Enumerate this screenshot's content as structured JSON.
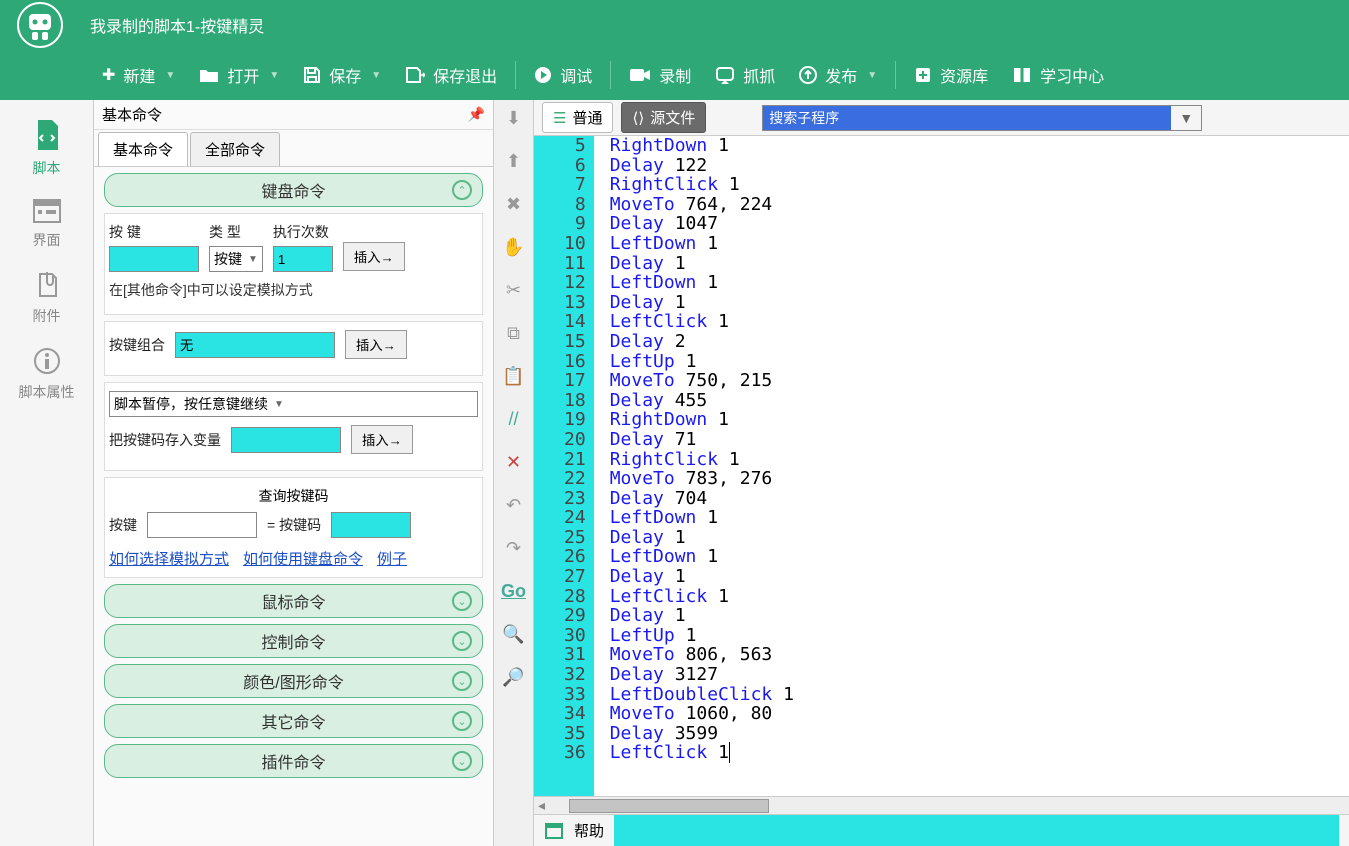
{
  "app": {
    "title": "我录制的脚本1-按键精灵"
  },
  "toolbar": {
    "new": "新建",
    "open": "打开",
    "save": "保存",
    "save_exit": "保存退出",
    "debug": "调试",
    "record": "录制",
    "grab": "抓抓",
    "publish": "发布",
    "resources": "资源库",
    "learn": "学习中心"
  },
  "rail": {
    "script": "脚本",
    "ui": "界面",
    "attach": "附件",
    "props": "脚本属性"
  },
  "panel": {
    "title": "基本命令",
    "tab_basic": "基本命令",
    "tab_all": "全部命令",
    "group_keyboard": "键盘命令",
    "key_label": "按 键",
    "type_label": "类 型",
    "count_label": "执行次数",
    "type_value": "按键",
    "count_value": "1",
    "insert": "插入→",
    "hint1": "在[其他命令]中可以设定模拟方式",
    "combo_label": "按键组合",
    "combo_value": "无",
    "pause_value": "脚本暂停，按任意键继续",
    "store_label": "把按键码存入变量",
    "lookup_title": "查询按键码",
    "lookup_key": "按键",
    "lookup_eq": "= 按键码",
    "link1": "如何选择模拟方式",
    "link2": "如何使用键盘命令",
    "link3": "例子",
    "group_mouse": "鼠标命令",
    "group_control": "控制命令",
    "group_color": "颜色/图形命令",
    "group_other": "其它命令",
    "group_plugin": "插件命令"
  },
  "editor": {
    "mode_normal": "普通",
    "mode_source": "源文件",
    "search_placeholder": "搜索子程序",
    "help_label": "帮助"
  },
  "code": [
    {
      "n": 5,
      "kw": "RightDown",
      "args": "1"
    },
    {
      "n": 6,
      "kw": "Delay",
      "args": "122"
    },
    {
      "n": 7,
      "kw": "RightClick",
      "args": "1"
    },
    {
      "n": 8,
      "kw": "MoveTo",
      "args": "764, 224"
    },
    {
      "n": 9,
      "kw": "Delay",
      "args": "1047"
    },
    {
      "n": 10,
      "kw": "LeftDown",
      "args": "1"
    },
    {
      "n": 11,
      "kw": "Delay",
      "args": "1"
    },
    {
      "n": 12,
      "kw": "LeftDown",
      "args": "1"
    },
    {
      "n": 13,
      "kw": "Delay",
      "args": "1"
    },
    {
      "n": 14,
      "kw": "LeftClick",
      "args": "1"
    },
    {
      "n": 15,
      "kw": "Delay",
      "args": "2"
    },
    {
      "n": 16,
      "kw": "LeftUp",
      "args": "1"
    },
    {
      "n": 17,
      "kw": "MoveTo",
      "args": "750, 215"
    },
    {
      "n": 18,
      "kw": "Delay",
      "args": "455"
    },
    {
      "n": 19,
      "kw": "RightDown",
      "args": "1"
    },
    {
      "n": 20,
      "kw": "Delay",
      "args": "71"
    },
    {
      "n": 21,
      "kw": "RightClick",
      "args": "1"
    },
    {
      "n": 22,
      "kw": "MoveTo",
      "args": "783, 276"
    },
    {
      "n": 23,
      "kw": "Delay",
      "args": "704"
    },
    {
      "n": 24,
      "kw": "LeftDown",
      "args": "1"
    },
    {
      "n": 25,
      "kw": "Delay",
      "args": "1"
    },
    {
      "n": 26,
      "kw": "LeftDown",
      "args": "1"
    },
    {
      "n": 27,
      "kw": "Delay",
      "args": "1"
    },
    {
      "n": 28,
      "kw": "LeftClick",
      "args": "1"
    },
    {
      "n": 29,
      "kw": "Delay",
      "args": "1"
    },
    {
      "n": 30,
      "kw": "LeftUp",
      "args": "1"
    },
    {
      "n": 31,
      "kw": "MoveTo",
      "args": "806, 563"
    },
    {
      "n": 32,
      "kw": "Delay",
      "args": "3127"
    },
    {
      "n": 33,
      "kw": "LeftDoubleClick",
      "args": "1"
    },
    {
      "n": 34,
      "kw": "MoveTo",
      "args": "1060, 80"
    },
    {
      "n": 35,
      "kw": "Delay",
      "args": "3599"
    },
    {
      "n": 36,
      "kw": "LeftClick",
      "args": "1"
    }
  ]
}
